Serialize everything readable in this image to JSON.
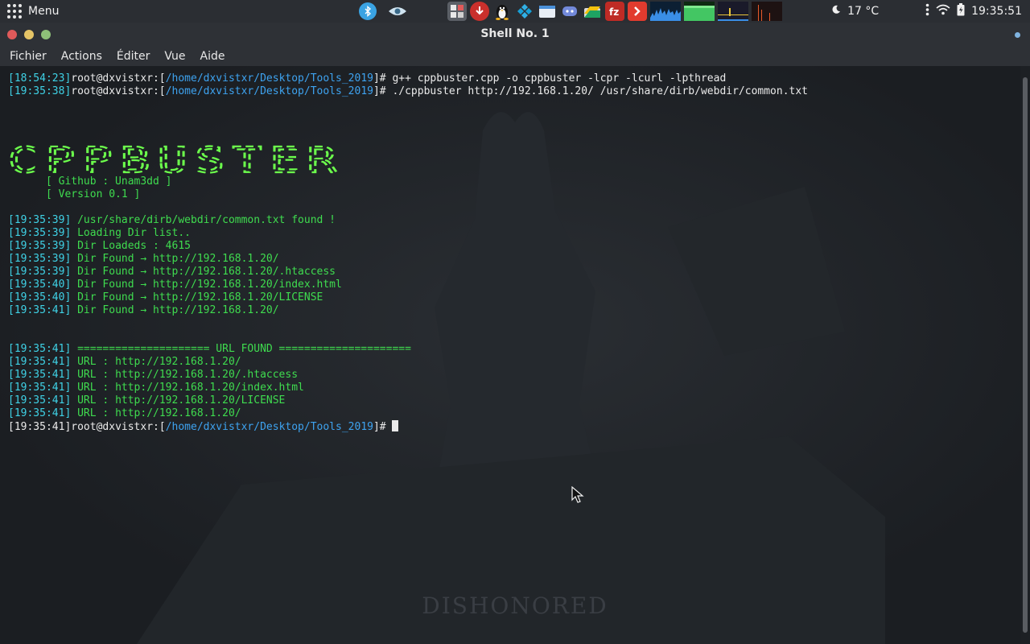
{
  "panel": {
    "menu_label": "Menu",
    "weather": "17 °C",
    "clock": "19:35:51",
    "tray_icons": [
      "bluetooth-icon",
      "eye-icon",
      "calculator-icon",
      "download-icon",
      "linux-icon",
      "kodi-icon",
      "files-icon",
      "discord-icon",
      "drive-icon",
      "filezilla-icon",
      "anydesk-icon",
      "cpu-monitor",
      "mem-monitor",
      "net-monitor",
      "load-monitor"
    ]
  },
  "window": {
    "title": "Shell No. 1",
    "menu": [
      "Fichier",
      "Actions",
      "Éditer",
      "Vue",
      "Aide"
    ]
  },
  "terminal": {
    "prompt_host": "root@dxvistxr:[",
    "prompt_path": "/home/dxvistxr/Desktop/Tools_2019",
    "prompt_end": "]# ",
    "cmd1_time": "[18:54:23]",
    "cmd1": "g++ cppbuster.cpp -o cppbuster -lcpr -lcurl -lpthread",
    "cmd2_time": "[19:35:38]",
    "cmd2": "./cppbuster http://192.168.1.20/ /usr/share/dirb/webdir/common.txt",
    "banner": "CPPBUSTER",
    "info": [
      "      [ Github : Unam3dd ]",
      "      [ Version 0.1 ]"
    ],
    "log": [
      {
        "time": "[19:35:39]",
        "msg": " /usr/share/dirb/webdir/common.txt found !"
      },
      {
        "time": "[19:35:39]",
        "msg": " Loading Dir list.."
      },
      {
        "time": "[19:35:39]",
        "msg": " Dir Loadeds : 4615"
      },
      {
        "time": "[19:35:39]",
        "msg": " Dir Found → http://192.168.1.20/"
      },
      {
        "time": "[19:35:39]",
        "msg": " Dir Found → http://192.168.1.20/.htaccess"
      },
      {
        "time": "[19:35:40]",
        "msg": " Dir Found → http://192.168.1.20/index.html"
      },
      {
        "time": "[19:35:40]",
        "msg": " Dir Found → http://192.168.1.20/LICENSE"
      },
      {
        "time": "[19:35:41]",
        "msg": " Dir Found → http://192.168.1.20/"
      }
    ],
    "found_header_time": "[19:35:41]",
    "found_header": " ===================== URL FOUND =====================",
    "urls": [
      {
        "time": "[19:35:41]",
        "msg": " URL : http://192.168.1.20/"
      },
      {
        "time": "[19:35:41]",
        "msg": " URL : http://192.168.1.20/.htaccess"
      },
      {
        "time": "[19:35:41]",
        "msg": " URL : http://192.168.1.20/index.html"
      },
      {
        "time": "[19:35:41]",
        "msg": " URL : http://192.168.1.20/LICENSE"
      },
      {
        "time": "[19:35:41]",
        "msg": " URL : http://192.168.1.20/"
      }
    ],
    "last_time": "[19:35:41]",
    "wallpaper_logo": "DISHONORED"
  }
}
